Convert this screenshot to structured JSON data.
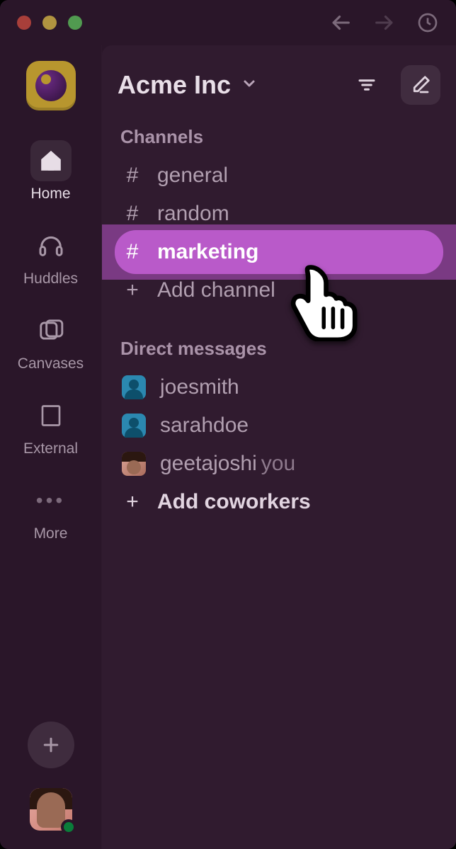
{
  "titlebar": {
    "traffic_lights": [
      "close",
      "minimize",
      "zoom"
    ]
  },
  "rail": {
    "items": [
      {
        "id": "home",
        "label": "Home",
        "active": true
      },
      {
        "id": "huddles",
        "label": "Huddles",
        "active": false
      },
      {
        "id": "canvases",
        "label": "Canvases",
        "active": false
      },
      {
        "id": "external",
        "label": "External",
        "active": false
      },
      {
        "id": "more",
        "label": "More",
        "active": false
      }
    ]
  },
  "workspace": {
    "name": "Acme Inc"
  },
  "sidebar": {
    "channels_header": "Channels",
    "channels": [
      {
        "name": "general",
        "selected": false
      },
      {
        "name": "random",
        "selected": false
      },
      {
        "name": "marketing",
        "selected": true
      }
    ],
    "add_channel_label": "Add channel",
    "dm_header": "Direct messages",
    "dms": [
      {
        "name": "joesmith",
        "avatar": "blue",
        "is_self": false
      },
      {
        "name": "sarahdoe",
        "avatar": "blue",
        "is_self": false
      },
      {
        "name": "geetajoshi",
        "avatar": "photo",
        "is_self": true
      }
    ],
    "you_label": "you",
    "add_coworkers_label": "Add coworkers"
  }
}
